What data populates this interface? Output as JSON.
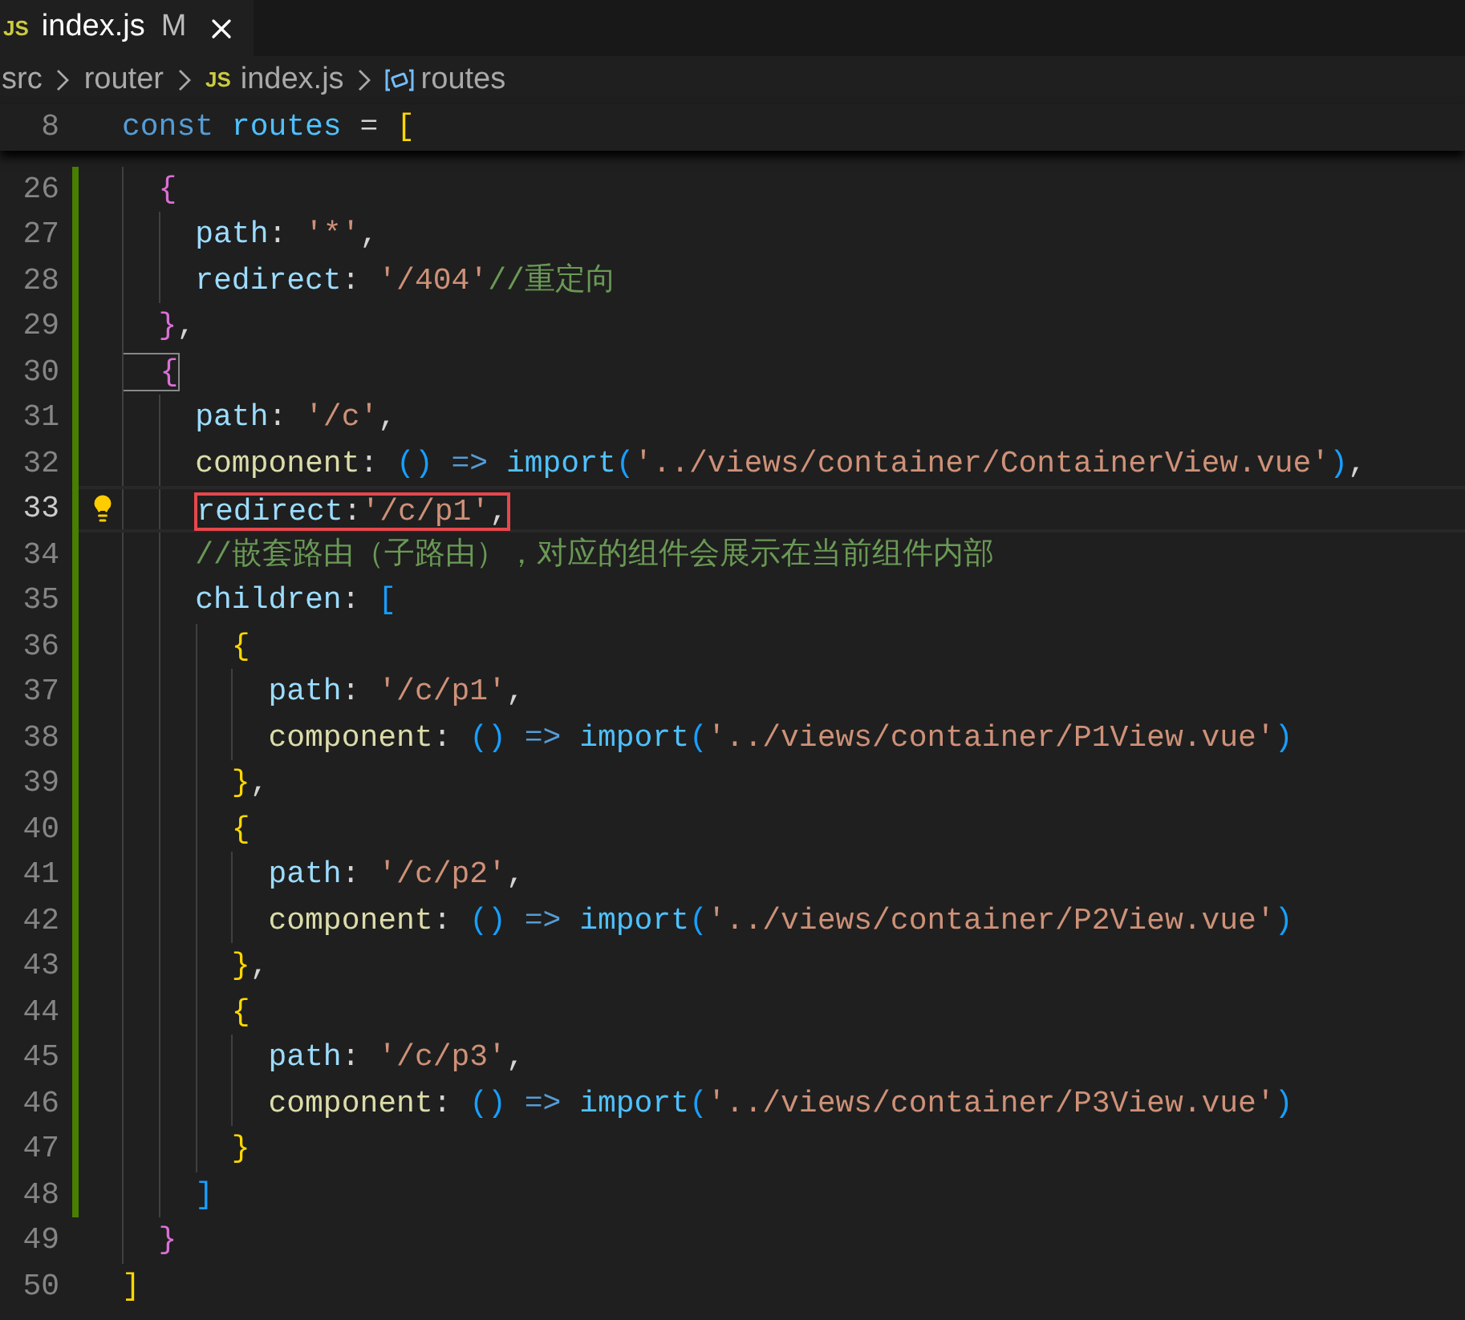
{
  "tab": {
    "badge": "JS",
    "title": "index.js",
    "status": "M",
    "selected": true
  },
  "breadcrumb": [
    {
      "kind": "folder",
      "label": "src"
    },
    {
      "kind": "folder",
      "label": "router"
    },
    {
      "kind": "file",
      "badge": "JS",
      "label": "index.js"
    },
    {
      "kind": "symbol",
      "label": "routes"
    }
  ],
  "sticky_line": {
    "number": "8",
    "tokens": [
      {
        "text": "const ",
        "kind": "kw"
      },
      {
        "text": "routes",
        "kind": "var"
      },
      {
        "text": " = ",
        "kind": "punc"
      },
      {
        "text": "[",
        "kind": "b1"
      }
    ]
  },
  "lines": [
    {
      "number": "26",
      "modified": true,
      "current": false,
      "boxed": false,
      "tokens": [
        {
          "text": "  {",
          "kind": "b2"
        }
      ]
    },
    {
      "number": "27",
      "modified": true,
      "current": false,
      "boxed": false,
      "tokens": [
        {
          "text": "    path",
          "kind": "key"
        },
        {
          "text": ": ",
          "kind": "punc"
        },
        {
          "text": "'*'",
          "kind": "str"
        },
        {
          "text": ",",
          "kind": "punc"
        }
      ]
    },
    {
      "number": "28",
      "modified": true,
      "current": false,
      "boxed": false,
      "tokens": [
        {
          "text": "    redirect",
          "kind": "key"
        },
        {
          "text": ": ",
          "kind": "punc"
        },
        {
          "text": "'/404'",
          "kind": "str"
        },
        {
          "text": "//重定向",
          "kind": "comment"
        }
      ]
    },
    {
      "number": "29",
      "modified": true,
      "current": false,
      "boxed": false,
      "tokens": [
        {
          "text": "  }",
          "kind": "b2"
        },
        {
          "text": ",",
          "kind": "punc"
        }
      ]
    },
    {
      "number": "30",
      "modified": true,
      "current": false,
      "boxed": false,
      "tokens": [
        {
          "text": "  {",
          "kind": "b2",
          "matched": true
        }
      ]
    },
    {
      "number": "31",
      "modified": true,
      "current": false,
      "boxed": false,
      "tokens": [
        {
          "text": "    path",
          "kind": "key"
        },
        {
          "text": ": ",
          "kind": "punc"
        },
        {
          "text": "'/c'",
          "kind": "str"
        },
        {
          "text": ",",
          "kind": "punc"
        }
      ]
    },
    {
      "number": "32",
      "modified": true,
      "current": false,
      "boxed": false,
      "tokens": [
        {
          "text": "    component",
          "kind": "fn"
        },
        {
          "text": ": ",
          "kind": "punc"
        },
        {
          "text": "()",
          "kind": "b3"
        },
        {
          "text": " => ",
          "kind": "kw"
        },
        {
          "text": "import",
          "kind": "var"
        },
        {
          "text": "(",
          "kind": "b3"
        },
        {
          "text": "'../views/container/ContainerView.vue'",
          "kind": "str"
        },
        {
          "text": ")",
          "kind": "b3"
        },
        {
          "text": ",",
          "kind": "punc"
        }
      ]
    },
    {
      "number": "33",
      "modified": true,
      "current": true,
      "boxed": true,
      "tokens": [
        {
          "text": "    redirect",
          "kind": "key"
        },
        {
          "text": ":",
          "kind": "punc"
        },
        {
          "text": "'/c/p1'",
          "kind": "str"
        },
        {
          "text": ",",
          "kind": "punc"
        }
      ]
    },
    {
      "number": "34",
      "modified": true,
      "current": false,
      "boxed": false,
      "tokens": [
        {
          "text": "    //嵌套路由（子路由），对应的组件会展示在当前组件内部",
          "kind": "comment"
        }
      ]
    },
    {
      "number": "35",
      "modified": true,
      "current": false,
      "boxed": false,
      "tokens": [
        {
          "text": "    children",
          "kind": "key"
        },
        {
          "text": ": ",
          "kind": "punc"
        },
        {
          "text": "[",
          "kind": "b3"
        }
      ]
    },
    {
      "number": "36",
      "modified": true,
      "current": false,
      "boxed": false,
      "tokens": [
        {
          "text": "      {",
          "kind": "b1"
        }
      ]
    },
    {
      "number": "37",
      "modified": true,
      "current": false,
      "boxed": false,
      "tokens": [
        {
          "text": "        path",
          "kind": "key"
        },
        {
          "text": ": ",
          "kind": "punc"
        },
        {
          "text": "'/c/p1'",
          "kind": "str"
        },
        {
          "text": ",",
          "kind": "punc"
        }
      ]
    },
    {
      "number": "38",
      "modified": true,
      "current": false,
      "boxed": false,
      "tokens": [
        {
          "text": "        component",
          "kind": "fn"
        },
        {
          "text": ": ",
          "kind": "punc"
        },
        {
          "text": "()",
          "kind": "b3"
        },
        {
          "text": " => ",
          "kind": "kw"
        },
        {
          "text": "import",
          "kind": "var"
        },
        {
          "text": "(",
          "kind": "b3"
        },
        {
          "text": "'../views/container/P1View.vue'",
          "kind": "str"
        },
        {
          "text": ")",
          "kind": "b3"
        }
      ]
    },
    {
      "number": "39",
      "modified": true,
      "current": false,
      "boxed": false,
      "tokens": [
        {
          "text": "      }",
          "kind": "b1"
        },
        {
          "text": ",",
          "kind": "punc"
        }
      ]
    },
    {
      "number": "40",
      "modified": true,
      "current": false,
      "boxed": false,
      "tokens": [
        {
          "text": "      {",
          "kind": "b1"
        }
      ]
    },
    {
      "number": "41",
      "modified": true,
      "current": false,
      "boxed": false,
      "tokens": [
        {
          "text": "        path",
          "kind": "key"
        },
        {
          "text": ": ",
          "kind": "punc"
        },
        {
          "text": "'/c/p2'",
          "kind": "str"
        },
        {
          "text": ",",
          "kind": "punc"
        }
      ]
    },
    {
      "number": "42",
      "modified": true,
      "current": false,
      "boxed": false,
      "tokens": [
        {
          "text": "        component",
          "kind": "fn"
        },
        {
          "text": ": ",
          "kind": "punc"
        },
        {
          "text": "()",
          "kind": "b3"
        },
        {
          "text": " => ",
          "kind": "kw"
        },
        {
          "text": "import",
          "kind": "var"
        },
        {
          "text": "(",
          "kind": "b3"
        },
        {
          "text": "'../views/container/P2View.vue'",
          "kind": "str"
        },
        {
          "text": ")",
          "kind": "b3"
        }
      ]
    },
    {
      "number": "43",
      "modified": true,
      "current": false,
      "boxed": false,
      "tokens": [
        {
          "text": "      }",
          "kind": "b1"
        },
        {
          "text": ",",
          "kind": "punc"
        }
      ]
    },
    {
      "number": "44",
      "modified": true,
      "current": false,
      "boxed": false,
      "tokens": [
        {
          "text": "      {",
          "kind": "b1"
        }
      ]
    },
    {
      "number": "45",
      "modified": true,
      "current": false,
      "boxed": false,
      "tokens": [
        {
          "text": "        path",
          "kind": "key"
        },
        {
          "text": ": ",
          "kind": "punc"
        },
        {
          "text": "'/c/p3'",
          "kind": "str"
        },
        {
          "text": ",",
          "kind": "punc"
        }
      ]
    },
    {
      "number": "46",
      "modified": true,
      "current": false,
      "boxed": false,
      "tokens": [
        {
          "text": "        component",
          "kind": "fn"
        },
        {
          "text": ": ",
          "kind": "punc"
        },
        {
          "text": "()",
          "kind": "b3"
        },
        {
          "text": " => ",
          "kind": "kw"
        },
        {
          "text": "import",
          "kind": "var"
        },
        {
          "text": "(",
          "kind": "b3"
        },
        {
          "text": "'../views/container/P3View.vue'",
          "kind": "str"
        },
        {
          "text": ")",
          "kind": "b3"
        }
      ]
    },
    {
      "number": "47",
      "modified": true,
      "current": false,
      "boxed": false,
      "tokens": [
        {
          "text": "      }",
          "kind": "b1"
        }
      ]
    },
    {
      "number": "48",
      "modified": true,
      "current": false,
      "boxed": false,
      "tokens": [
        {
          "text": "    ]",
          "kind": "b3"
        }
      ]
    },
    {
      "number": "49",
      "modified": false,
      "current": false,
      "boxed": false,
      "tokens": [
        {
          "text": "  }",
          "kind": "b2"
        }
      ]
    },
    {
      "number": "50",
      "modified": false,
      "current": false,
      "boxed": false,
      "tokens": [
        {
          "text": "]",
          "kind": "b1"
        }
      ]
    }
  ]
}
